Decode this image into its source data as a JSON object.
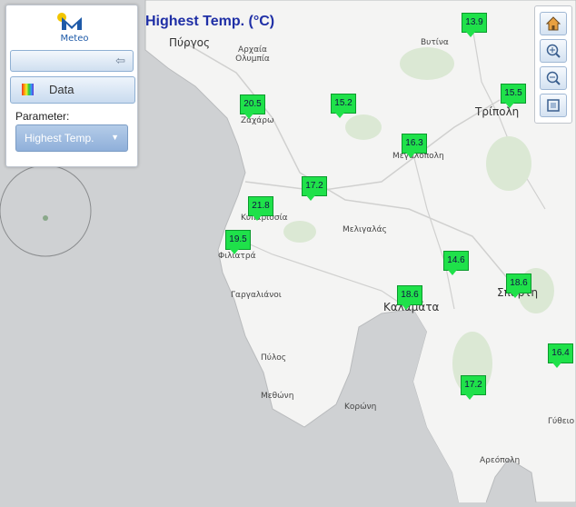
{
  "title": "Highest Temp. (°C)",
  "logo": {
    "text": "Meteo"
  },
  "panel": {
    "collapse_icon": "arrow-left-icon",
    "data_label": "Data",
    "parameter_label": "Parameter:",
    "parameter_value": "Highest Temp."
  },
  "zoom_controls": [
    "home-icon",
    "zoom-in-icon",
    "zoom-out-icon",
    "zoom-extent-icon"
  ],
  "place_labels": [
    {
      "name": "Πύργος",
      "size": "big"
    },
    {
      "name": "Αρχαία Ολυμπία",
      "size": "small"
    },
    {
      "name": "Βυτίνα",
      "size": "small"
    },
    {
      "name": "Ζαχάρω",
      "size": "small"
    },
    {
      "name": "Τρίπολη",
      "size": "big"
    },
    {
      "name": "Μεγαλόπολη",
      "size": "small"
    },
    {
      "name": "Κυπαρισσία",
      "size": "small"
    },
    {
      "name": "Μελιγαλάς",
      "size": "small"
    },
    {
      "name": "Φιλιατρά",
      "size": "small"
    },
    {
      "name": "Γαργαλιάνοι",
      "size": "small"
    },
    {
      "name": "Καλαμάτα",
      "size": "big"
    },
    {
      "name": "Σπάρτη",
      "size": "big"
    },
    {
      "name": "Πύλος",
      "size": "small"
    },
    {
      "name": "Μεθώνη",
      "size": "small"
    },
    {
      "name": "Κορώνη",
      "size": "small"
    },
    {
      "name": "Γύθειο",
      "size": "small"
    },
    {
      "name": "Αρεόπολη",
      "size": "small"
    }
  ],
  "stations": [
    {
      "value": "13.9"
    },
    {
      "value": "15.5"
    },
    {
      "value": "20.5"
    },
    {
      "value": "15.2"
    },
    {
      "value": "16.3"
    },
    {
      "value": "17.2"
    },
    {
      "value": "21.8"
    },
    {
      "value": "19.5"
    },
    {
      "value": "14.6"
    },
    {
      "value": "18.6"
    },
    {
      "value": "18.6"
    },
    {
      "value": "16.4"
    },
    {
      "value": "17.2"
    }
  ]
}
